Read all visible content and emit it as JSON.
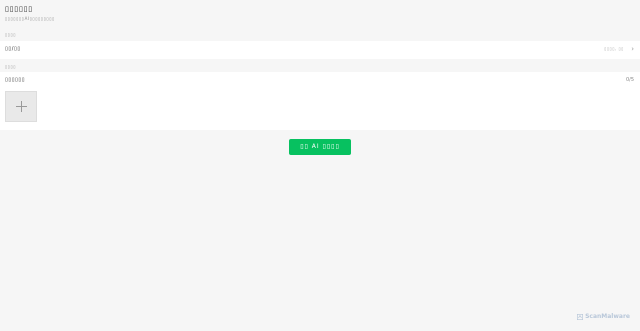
{
  "header": {
    "title": "▯▯▯▯▯▯",
    "subtitle": "▯▯▯▯▯▯▯AI▯▯▯▯▯▯▯▯▯"
  },
  "sections": [
    {
      "label": "▯▯▯▯",
      "row": {
        "label": "▯▯/▯▯",
        "value": "▯▯▯▯, ▯▯",
        "chevron": "›"
      }
    },
    {
      "label": "▯▯▯▯",
      "row": {
        "label": "▯▯▯▯▯▯",
        "count": "0/5"
      }
    }
  ],
  "upload": {
    "icon": "plus-icon"
  },
  "submit": {
    "label": "▯▯ AI ▯▯▯▯"
  },
  "watermark": {
    "text": "ScanMalware",
    "icon": "scanmalware-logo-icon"
  },
  "colors": {
    "accent": "#07c160",
    "background": "#f6f6f6",
    "card": "#ffffff"
  }
}
